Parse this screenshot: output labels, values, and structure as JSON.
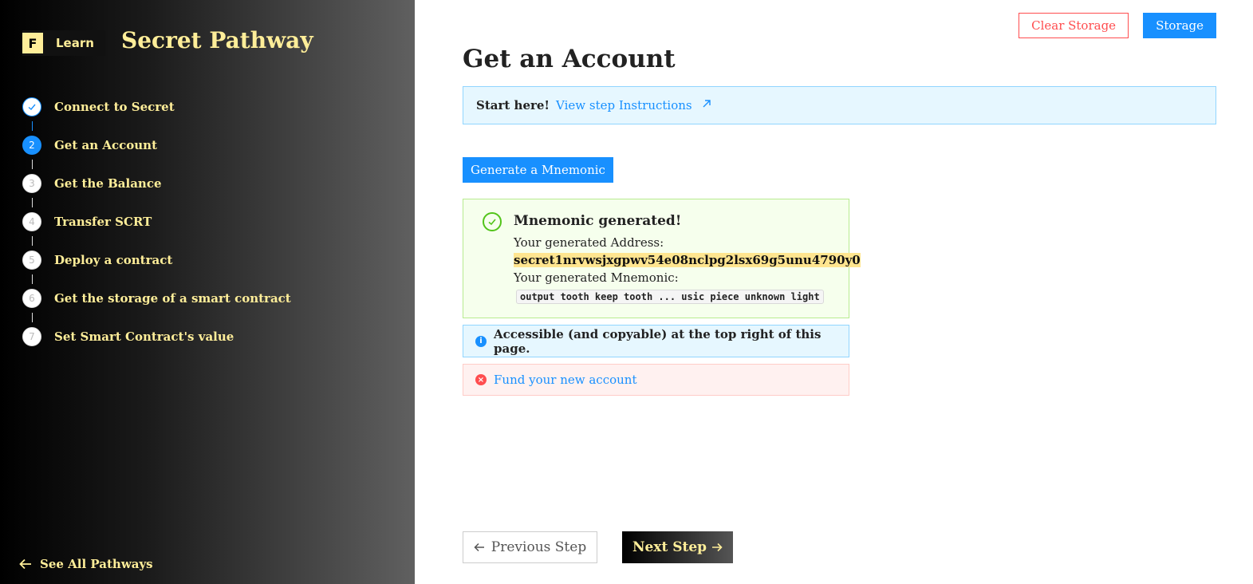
{
  "sidebar": {
    "logo_letter": "F",
    "logo_text": "Learn",
    "title": "Secret Pathway",
    "steps": [
      {
        "number": "1",
        "label": "Connect to Secret",
        "state": "done"
      },
      {
        "number": "2",
        "label": "Get an Account",
        "state": "current"
      },
      {
        "number": "3",
        "label": "Get the Balance",
        "state": "todo"
      },
      {
        "number": "4",
        "label": "Transfer SCRT",
        "state": "todo"
      },
      {
        "number": "5",
        "label": "Deploy a contract",
        "state": "todo"
      },
      {
        "number": "6",
        "label": "Get the storage of a smart contract",
        "state": "todo"
      },
      {
        "number": "7",
        "label": "Set Smart Contract's value",
        "state": "todo"
      }
    ],
    "see_all": "See All Pathways"
  },
  "header": {
    "clear_storage": "Clear Storage",
    "storage": "Storage"
  },
  "main": {
    "title": "Get an Account",
    "instructions": {
      "lead": "Start here!",
      "link": "View step Instructions"
    },
    "generate_button": "Generate a Mnemonic",
    "success": {
      "title": "Mnemonic generated!",
      "address_label": "Your generated Address:",
      "address": "secret1nrvwsjxgpwv54e08nclpg2lsx69g5unu4790y0",
      "mnemonic_label": "Your generated Mnemonic:",
      "mnemonic": "output tooth keep tooth ... usic piece unknown light"
    },
    "info": "Accessible (and copyable) at the top right of this page.",
    "error_link": "Fund your new account"
  },
  "nav": {
    "previous": "Previous Step",
    "next": "Next Step"
  },
  "colors": {
    "accent": "#1890ff",
    "brand_yellow": "#ffee99",
    "danger": "#ff4d4f",
    "success": "#52c41a"
  }
}
